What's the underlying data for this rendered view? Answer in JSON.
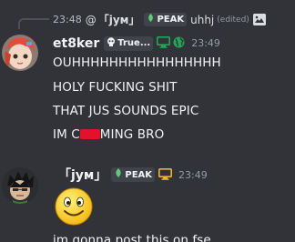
{
  "reply": {
    "time": "23:48",
    "at": "@",
    "user": "「jyм」",
    "tag": "PEAK",
    "text": "uhhj",
    "edited": "(edited)"
  },
  "message1": {
    "username": "et8ker",
    "badge": "True...",
    "time": "23:49",
    "lines": {
      "l1": "OUHHHHHHHHHHHHHHHH",
      "l2": "HOLY FUCKING SHIT",
      "l3": "THAT JUS SOUNDS EPIC",
      "l4a": "IM C",
      "l4b": "MING BRO"
    }
  },
  "message2": {
    "username": "「jyм」",
    "badge": "PEAK",
    "time": "23:49",
    "line": "im gonna post this on fse"
  },
  "colors": {
    "background": "#313338",
    "redaction": "#e4112b",
    "status_green": "#23a55a",
    "desktop_icon": "#f0b232"
  },
  "icons": {
    "skull": "skull-icon",
    "desktop": "desktop-icon",
    "globe": "globe-icon",
    "image": "image-icon",
    "leaf": "leaf-icon"
  }
}
